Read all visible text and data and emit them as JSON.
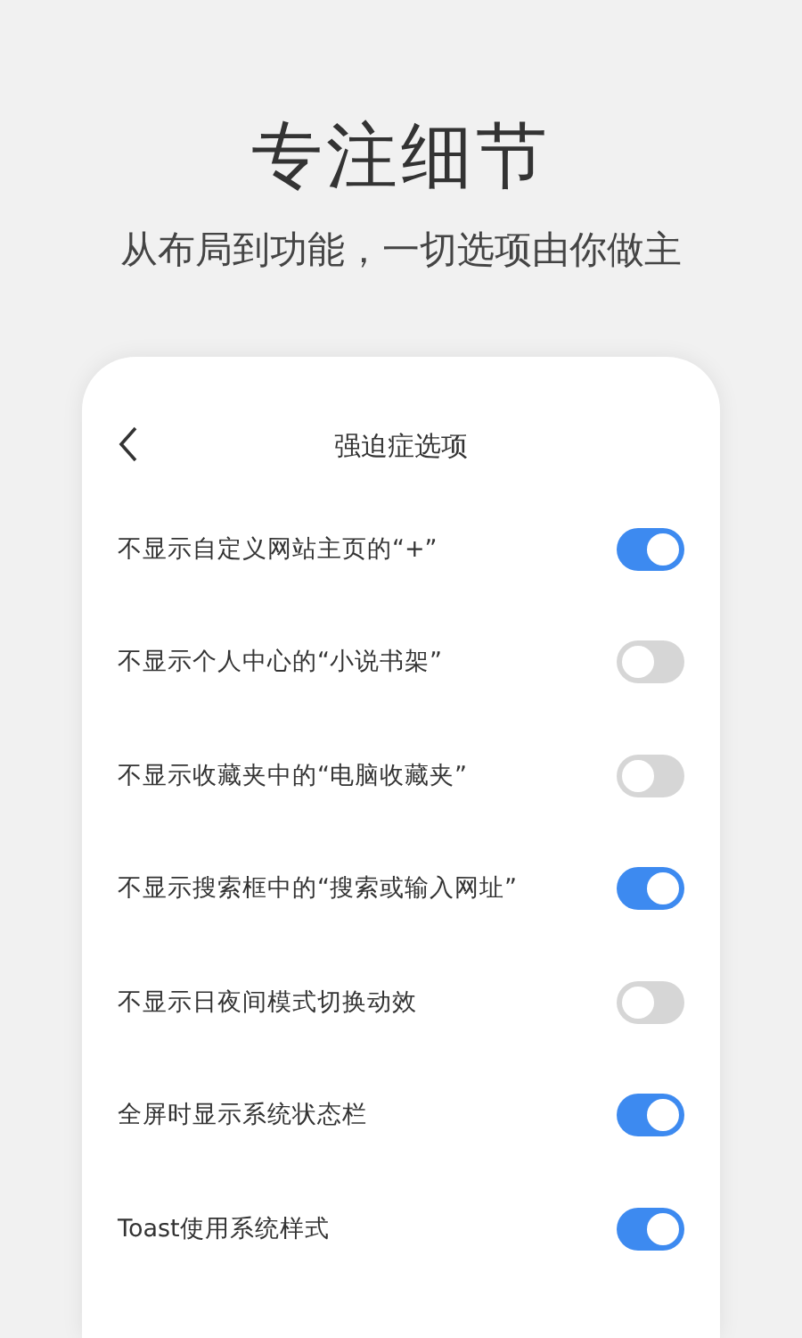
{
  "headline": "专注细节",
  "subtitle": "从布局到功能，一切选项由你做主",
  "screen": {
    "title": "强迫症选项",
    "options": [
      {
        "label": "不显示自定义网站主页的“+”",
        "on": true
      },
      {
        "label": "不显示个人中心的“小说书架”",
        "on": false
      },
      {
        "label": "不显示收藏夹中的“电脑收藏夹”",
        "on": false
      },
      {
        "label": "不显示搜索框中的“搜索或输入网址”",
        "on": true
      },
      {
        "label": "不显示日夜间模式切换动效",
        "on": false
      },
      {
        "label": "全屏时显示系统状态栏",
        "on": true
      },
      {
        "label": "Toast使用系统样式",
        "on": true
      }
    ]
  }
}
